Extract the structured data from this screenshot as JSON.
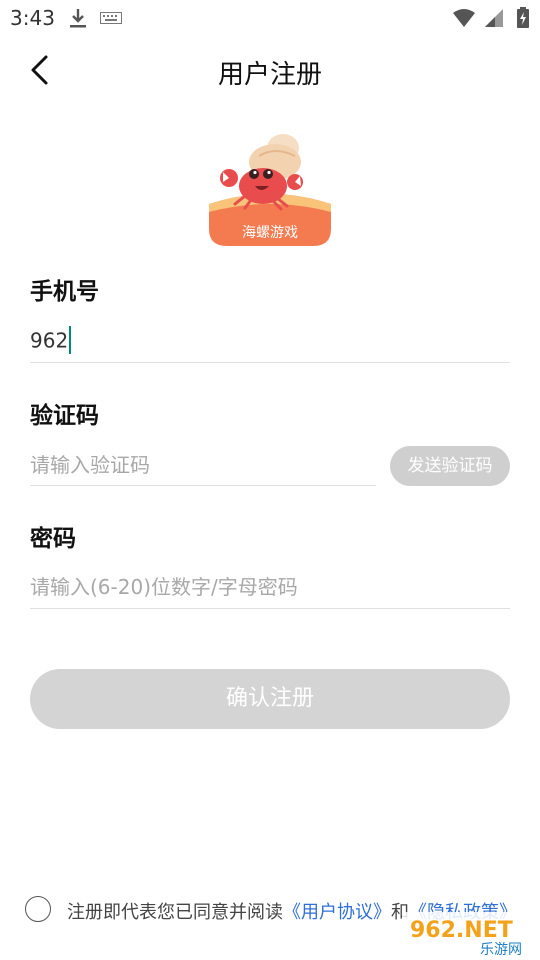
{
  "status_bar": {
    "time": "3:43",
    "icons": [
      "download-icon",
      "keyboard-icon",
      "wifi-icon",
      "cell-signal-icon",
      "battery-icon"
    ]
  },
  "header": {
    "title": "用户注册",
    "back_icon": "chevron-left-icon"
  },
  "logo": {
    "text": "海螺游戏"
  },
  "phone": {
    "label": "手机号",
    "value": "962"
  },
  "code": {
    "label": "验证码",
    "placeholder": "请输入验证码",
    "send_button": "发送验证码"
  },
  "password": {
    "label": "密码",
    "placeholder": "请输入(6-20)位数字/字母密码"
  },
  "submit": {
    "label": "确认注册"
  },
  "agreement": {
    "prefix": "注册即代表您已同意并阅读",
    "user_agreement": "《用户协议》",
    "and": "和",
    "privacy_policy": "《隐私政策》"
  },
  "watermark": {
    "brand": "962.NET",
    "sub": "乐游网"
  },
  "colors": {
    "accent_link": "#2f6fd6",
    "caret": "#00897b",
    "button_disabled": "#d4d4d4",
    "logo_orange": "#f26a4b"
  }
}
